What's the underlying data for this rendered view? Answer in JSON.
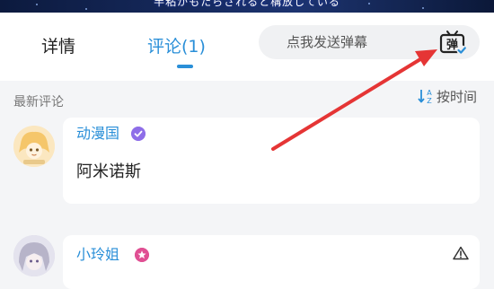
{
  "video": {
    "subtitle": "半粘がもたらされると構放している"
  },
  "tabs": [
    {
      "label": "详情",
      "active": false
    },
    {
      "label": "评论(1)",
      "active": true
    }
  ],
  "danmaku": {
    "placeholder": "点我发送弹幕",
    "icon_glyph": "弹",
    "icon": "danmaku-toggle-icon"
  },
  "comments_section": {
    "title": "最新评论",
    "sort_label": "按时间",
    "sort_icon": "sort-az-icon"
  },
  "comments": [
    {
      "username": "动漫国",
      "badge": "verified-badge",
      "text": "阿米诺斯"
    },
    {
      "username": "小玲姐",
      "badge": "star-badge",
      "text": ""
    }
  ],
  "colors": {
    "accent": "#2a8fd8",
    "arrow": "#e53535",
    "verified_badge": "#8e6ee8",
    "star_badge": "#e04f93"
  }
}
